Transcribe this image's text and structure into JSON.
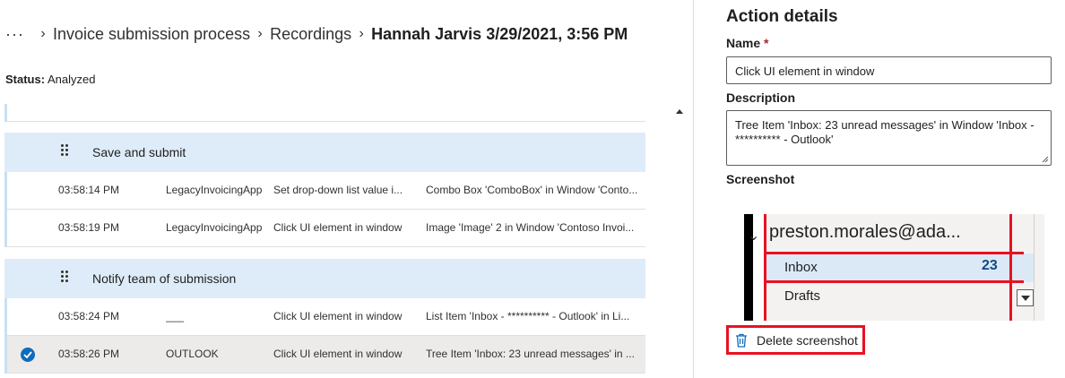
{
  "breadcrumb": {
    "more": "···",
    "items": [
      "Invoice submission process",
      "Recordings"
    ],
    "current": "Hannah Jarvis 3/29/2021, 3:56 PM"
  },
  "status": {
    "label": "Status:",
    "value": "Analyzed"
  },
  "groups": [
    {
      "title": "Save and submit",
      "rows": [
        {
          "time": "03:58:14 PM",
          "app": "LegacyInvoicingApp",
          "action": "Set drop-down list value i...",
          "target": "Combo Box 'ComboBox' in Window 'Conto..."
        },
        {
          "time": "03:58:19 PM",
          "app": "LegacyInvoicingApp",
          "action": "Click UI element in window",
          "target": "Image 'Image' 2 in Window 'Contoso Invoi..."
        }
      ]
    },
    {
      "title": "Notify team of submission",
      "rows": [
        {
          "time": "03:58:24 PM",
          "app": "___",
          "action": "Click UI element in window",
          "target": "List Item 'Inbox - ********** - Outlook' in Li..."
        },
        {
          "time": "03:58:26 PM",
          "app": "OUTLOOK",
          "action": "Click UI element in window",
          "target": "Tree Item 'Inbox: 23 unread messages' in ...",
          "selected": true
        }
      ]
    }
  ],
  "panel": {
    "title": "Action details",
    "name_label": "Name",
    "required_mark": "*",
    "name_value": "Click UI element in window",
    "description_label": "Description",
    "description_value": "Tree Item 'Inbox: 23 unread messages' in Window 'Inbox - ********** - Outlook'",
    "screenshot_label": "Screenshot",
    "screenshot": {
      "account": "preston.morales@ada...",
      "inbox": "Inbox",
      "inbox_count": "23",
      "drafts": "Drafts"
    },
    "delete_label": "Delete screenshot"
  },
  "colors": {
    "group_header_bg": "#deecf9",
    "selected_row_bg": "#edebe9",
    "accent_blue": "#0f6cbd",
    "highlight_red": "#e81123"
  }
}
